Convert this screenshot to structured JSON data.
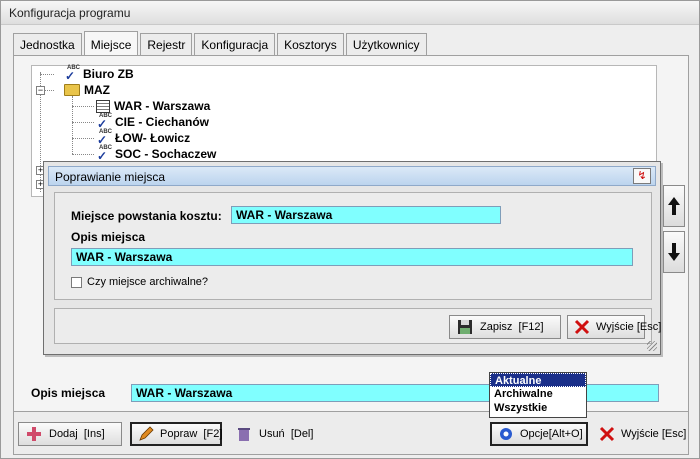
{
  "window": {
    "title": "Konfiguracja programu"
  },
  "tabs": [
    {
      "label": "Jednostka"
    },
    {
      "label": "Miejsce",
      "active": true
    },
    {
      "label": "Rejestr"
    },
    {
      "label": "Konfiguracja"
    },
    {
      "label": "Kosztorys"
    },
    {
      "label": "Użytkownicy"
    }
  ],
  "tree": {
    "items": [
      {
        "label": "Biuro ZB",
        "icon": "abc-check-icon"
      },
      {
        "label": "MAZ",
        "icon": "open-folder-icon"
      },
      {
        "label": "WAR - Warszawa",
        "icon": "catalog-icon"
      },
      {
        "label": "CIE - Ciechanów",
        "icon": "abc-check-icon"
      },
      {
        "label": "ŁOW- Łowicz",
        "icon": "abc-check-icon"
      },
      {
        "label": "SOC - Sochaczew",
        "icon": "abc-check-icon"
      }
    ]
  },
  "dialog": {
    "title": "Poprawianie miejsca",
    "cost_place_label": "Miejsce powstania kosztu:",
    "cost_place_value": "WAR - Warszawa",
    "description_label": "Opis miejsca",
    "description_value": "WAR - Warszawa",
    "archival_label": "Czy miejsce archiwalne?",
    "archival_checked": false,
    "save_label": "Zapisz",
    "save_key": "[F12]",
    "exit_label": "Wyjście",
    "exit_key": "[Esc]"
  },
  "bottom": {
    "description_label": "Opis miejsca",
    "description_value": "WAR - Warszawa",
    "add_label": "Dodaj",
    "add_key": "[Ins]",
    "edit_label": "Popraw",
    "edit_key": "[F2]",
    "delete_label": "Usuń",
    "delete_key": "[Del]",
    "options_label": "Opcje[Alt+O]",
    "exit_label": "Wyjście",
    "exit_key": "[Esc]"
  },
  "options_dropdown": {
    "items": [
      "Aktualne",
      "Archiwalne",
      "Wszystkie"
    ],
    "selected": "Aktualne"
  },
  "colors": {
    "field_bg": "#80ffff",
    "selection": "#1a2f8a",
    "dialog_title_bg": "#bcd4ee"
  }
}
